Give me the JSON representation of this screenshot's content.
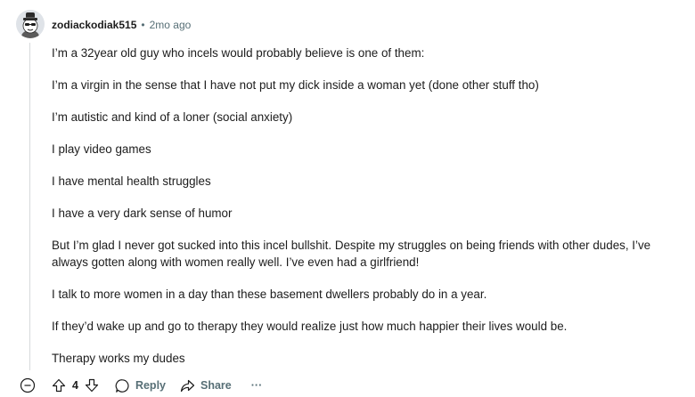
{
  "comment": {
    "username": "zodiackodiak515",
    "separator": "•",
    "timestamp": "2mo ago",
    "paragraphs": [
      "I’m a 32year old guy who incels would probably believe is one of them:",
      "I’m a virgin in the sense that I have not put my dick inside a woman yet (done other stuff tho)",
      "I’m autistic and kind of a loner (social anxiety)",
      "I play video games",
      "I have mental health struggles",
      "I have a very dark sense of humor",
      "But I’m glad I never got sucked into this incel bullshit. Despite my struggles on being friends with other dudes, I’ve always gotten along with women really well. I’ve even had a girlfriend!",
      "I talk to more women in a day than these basement dwellers probably do in a year.",
      "If they’d wake up and go to therapy they would realize just how much happier their lives would be.",
      "Therapy works my dudes"
    ],
    "score": "4",
    "actions": {
      "reply_label": "Reply",
      "share_label": "Share",
      "more_label": "···"
    }
  },
  "icons": {
    "avatar": "avatar-snoo-icon",
    "collapse": "collapse-minus-icon",
    "upvote": "upvote-arrow-icon",
    "downvote": "downvote-arrow-icon",
    "reply": "speech-bubble-icon",
    "share": "share-arrow-icon"
  },
  "colors": {
    "text": "#1c1c1c",
    "meta": "#576f76",
    "thread_line": "#d7dadc"
  }
}
